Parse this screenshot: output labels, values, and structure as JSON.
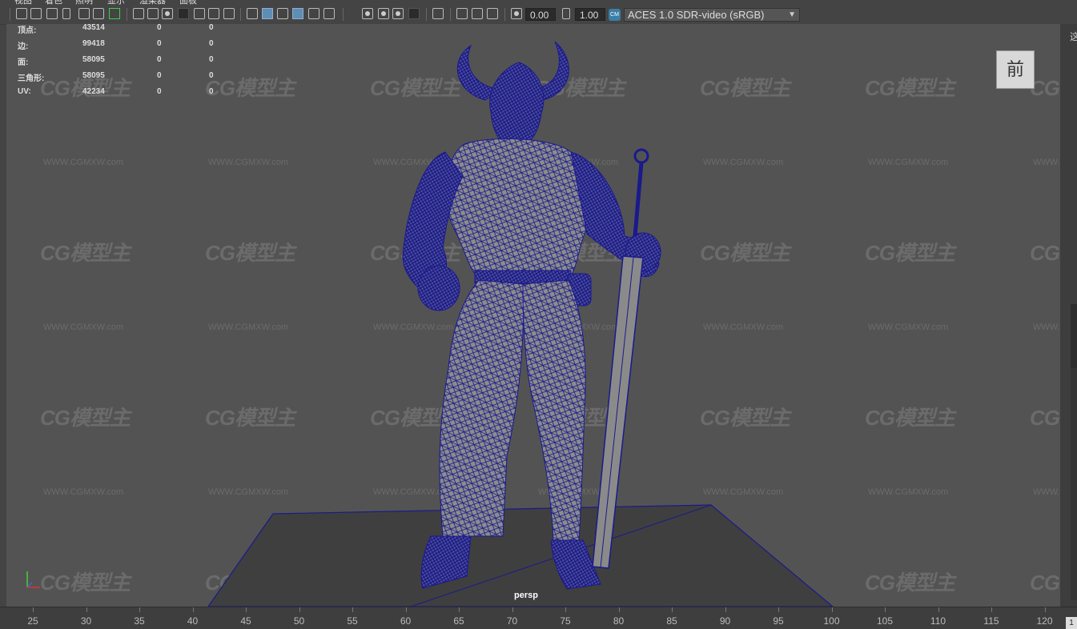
{
  "menu": [
    "视图",
    "着色",
    "照明",
    "显示",
    "渲染器",
    "面板"
  ],
  "toolbar": {
    "exposure_value": "0.00",
    "gamma_value": "1.00",
    "color_space": "ACES 1.0 SDR-video (sRGB)"
  },
  "hud_stats": [
    {
      "label": "顶点:",
      "value": "43514",
      "sel": "0",
      "comp": "0"
    },
    {
      "label": "边:",
      "value": "99418",
      "sel": "0",
      "comp": "0"
    },
    {
      "label": "面:",
      "value": "58095",
      "sel": "0",
      "comp": "0"
    },
    {
      "label": "三角形:",
      "value": "58095",
      "sel": "0",
      "comp": "0"
    },
    {
      "label": "UV:",
      "value": "42234",
      "sel": "0",
      "comp": "0"
    }
  ],
  "viewcube_label": "前",
  "camera_label": "persp",
  "watermark": {
    "logo": "CG模型主",
    "url": "WWW.CGMXW.com"
  },
  "timeline_ticks": [
    "25",
    "30",
    "35",
    "40",
    "45",
    "50",
    "55",
    "60",
    "65",
    "70",
    "75",
    "80",
    "85",
    "90",
    "95",
    "100",
    "105",
    "110",
    "115",
    "120"
  ],
  "timeline_end": "1",
  "right_edge_glyph": "这",
  "colors": {
    "wireframe": "#1a1a8c",
    "background": "#535353"
  }
}
